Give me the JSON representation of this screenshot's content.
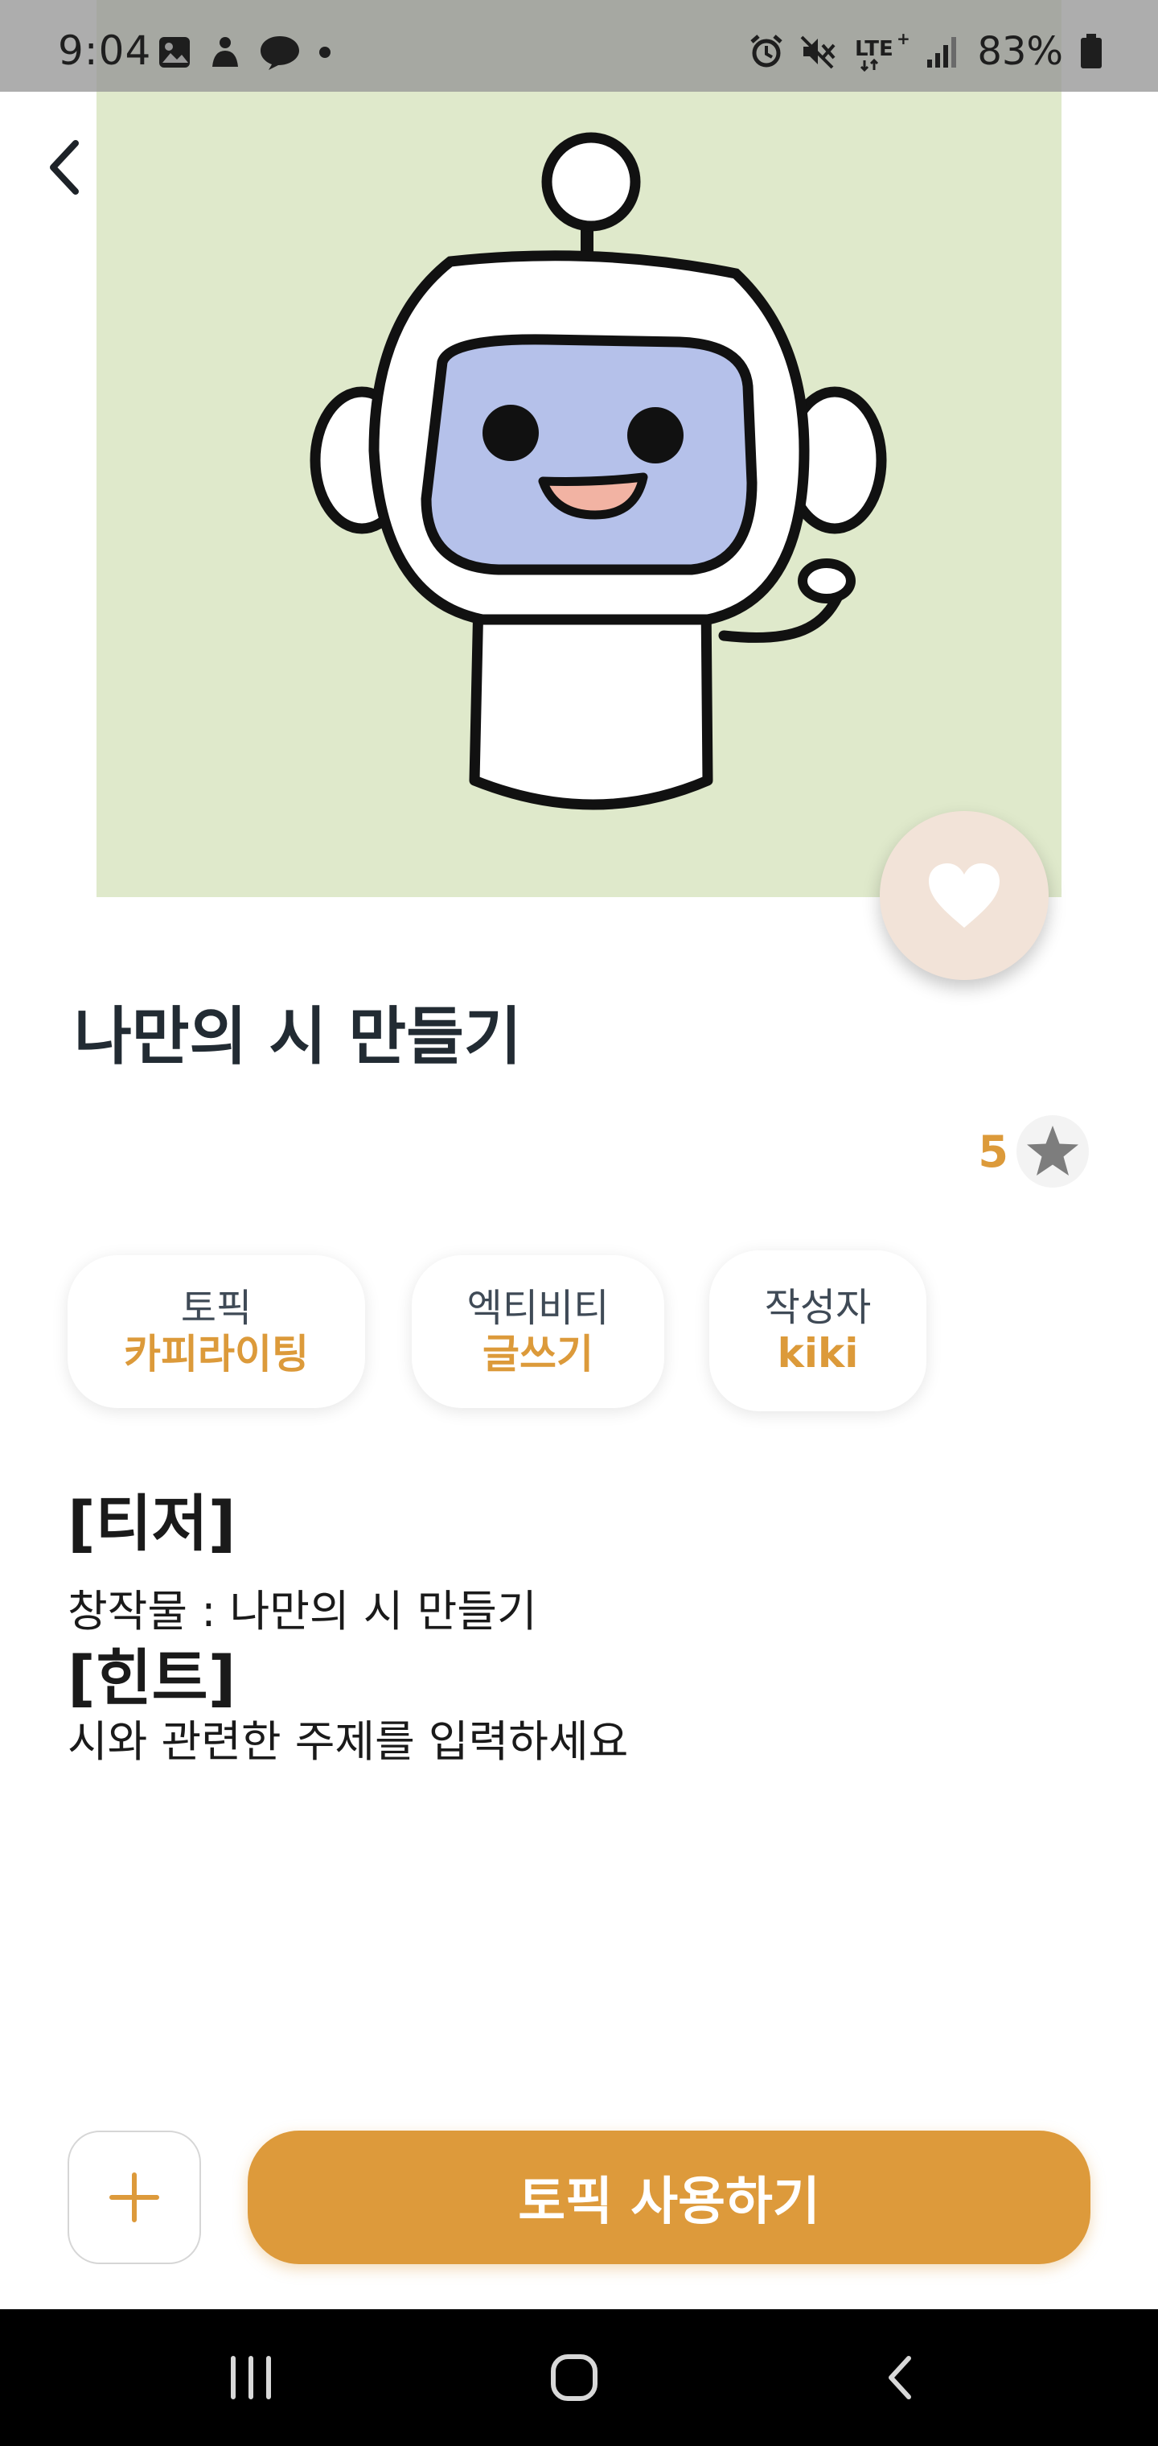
{
  "status_bar": {
    "time": "9:04",
    "battery": "83%",
    "network": "LTE+",
    "left_icons": [
      "image-icon",
      "notification-app-icon",
      "chat-bubble-icon",
      "dot-icon"
    ],
    "right_icons": [
      "alarm-icon",
      "mute-icon",
      "lte-icon",
      "signal-icon",
      "battery-icon"
    ]
  },
  "hero": {
    "background_color": "#dfe9cb",
    "robot_face_color": "#b5c1ea",
    "robot_mouth_color": "#f2b3a3"
  },
  "actions": {
    "back_icon": "chevron-left-icon",
    "like_icon": "heart-icon"
  },
  "topic": {
    "title": "나만의 시 만들기",
    "rating": "5",
    "rating_icon": "star-icon"
  },
  "chips": [
    {
      "label": "토픽",
      "value": "카피라이팅"
    },
    {
      "label": "엑티비티",
      "value": "글쓰기"
    },
    {
      "label": "작성자",
      "value": "kiki"
    }
  ],
  "description": {
    "teaser_heading": "[티저]",
    "teaser_text": "창작물 : 나만의 시 만들기",
    "hint_heading": "[힌트]",
    "hint_text": "시와 관련한 주제를 입력하세요"
  },
  "bottom": {
    "add_icon": "plus-icon",
    "cta_label": "토픽 사용하기"
  },
  "colors": {
    "accent": "#dd9a3b",
    "title": "#222b33",
    "like_bg": "#f2e3d8"
  },
  "nav_bar": {
    "icons": [
      "recent-apps-icon",
      "home-icon",
      "back-nav-icon"
    ]
  }
}
